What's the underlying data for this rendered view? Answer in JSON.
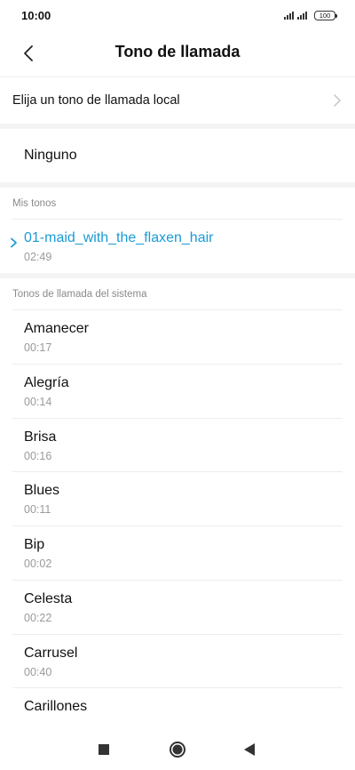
{
  "status_bar": {
    "time": "10:00",
    "battery": "100",
    "signal_icons": [
      "signal-icon",
      "signal-icon"
    ]
  },
  "header": {
    "title": "Tono de llamada",
    "back_icon": "chevron-left-icon"
  },
  "local_tone": {
    "label": "Elija un tono de llamada local",
    "icon": "chevron-right-icon"
  },
  "none_option": {
    "label": "Ninguno"
  },
  "my_tones": {
    "header": "Mis tonos",
    "items": [
      {
        "name": "01-maid_with_the_flaxen_hair",
        "duration": "02:49",
        "selected": true
      }
    ]
  },
  "system_tones": {
    "header": "Tonos de llamada del sistema",
    "items": [
      {
        "name": "Amanecer",
        "duration": "00:17"
      },
      {
        "name": "Alegría",
        "duration": "00:14"
      },
      {
        "name": "Brisa",
        "duration": "00:16"
      },
      {
        "name": "Blues",
        "duration": "00:11"
      },
      {
        "name": "Bip",
        "duration": "00:02"
      },
      {
        "name": "Celesta",
        "duration": "00:22"
      },
      {
        "name": "Carrusel",
        "duration": "00:40"
      },
      {
        "name": "Carillones",
        "duration": ""
      }
    ]
  },
  "nav_bar": {
    "icons": [
      "recents-square-icon",
      "home-circle-icon",
      "back-triangle-icon"
    ]
  },
  "colors": {
    "accent": "#1b9ad6",
    "secondary_text": "#9a9a9a",
    "section_bg": "#f4f4f4"
  }
}
